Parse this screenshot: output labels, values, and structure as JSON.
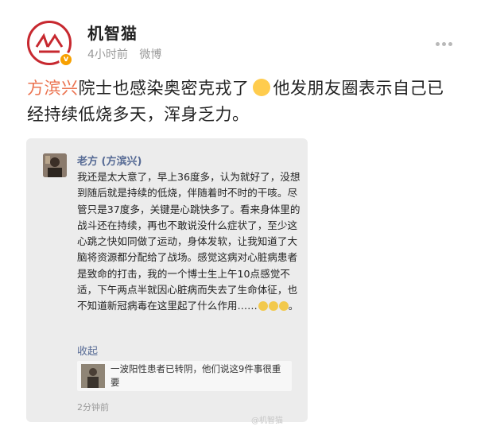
{
  "post": {
    "author": "机智猫",
    "time": "4小时前",
    "source": "微博",
    "mention": "方滨兴",
    "text_part1": "院士也感染奥密克戎了",
    "text_part2": "他发朋友圈表示自己已经持续低烧多天，浑身乏力。"
  },
  "moment": {
    "name": "老方 (方滨兴)",
    "body": "我还是太大意了，早上36度多，认为就好了，没想到随后就是持续的低烧，伴随着时不时的干咳。尽管只是37度多，关键是心跳快多了。看来身体里的战斗还在持续，再也不敢说没什么症状了，至少这心跳之快如同做了运动，身体发软，让我知道了大脑将资源都分配给了战场。感觉这病对心脏病患者是致命的打击，我的一个博士生上午10点感觉不适，下午两点半就因心脏病而失去了生命体征，也不知道新冠病毒在这里起了什么作用……",
    "collapse": "收起",
    "link_text": "一波阳性患者已转阴，他们说这9件事很重要",
    "time_ago": "2分钟前"
  },
  "watermark": "@机智猫",
  "colors": {
    "mention": "#eb7350",
    "link_blue": "#576b95",
    "avatar_ring": "#c7282f",
    "verified": "#f7a000"
  }
}
